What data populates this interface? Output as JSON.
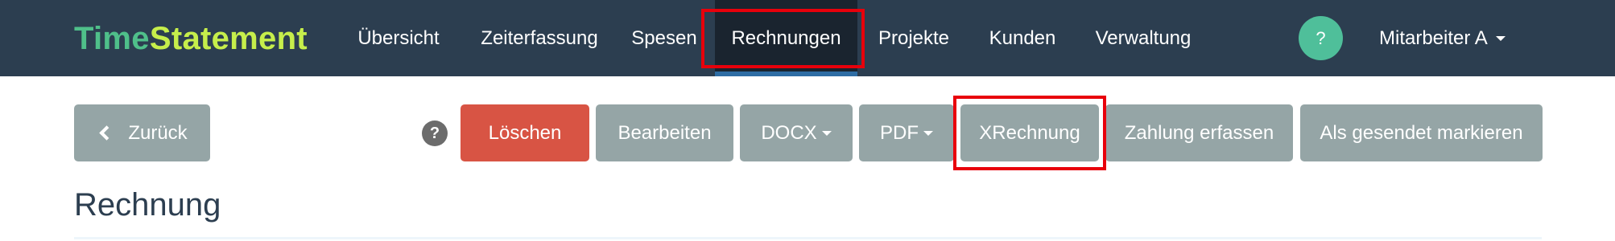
{
  "brand": {
    "part1": "Time",
    "part2": "Statement"
  },
  "nav": {
    "items": [
      {
        "label": "Übersicht"
      },
      {
        "label": "Zeiterfassung"
      },
      {
        "label": "Spesen"
      },
      {
        "label": "Rechnungen"
      },
      {
        "label": "Projekte"
      },
      {
        "label": "Kunden"
      },
      {
        "label": "Verwaltung"
      }
    ],
    "active": "Rechnungen",
    "help_label": "?",
    "user_label": "Mitarbeiter A"
  },
  "toolbar": {
    "back_label": "Zurück",
    "help_label": "?",
    "delete_label": "Löschen",
    "edit_label": "Bearbeiten",
    "docx_label": "DOCX",
    "pdf_label": "PDF",
    "xrechnung_label": "XRechnung",
    "payment_label": "Zahlung erfassen",
    "mark_sent_label": "Als gesendet markieren"
  },
  "page": {
    "title": "Rechnung"
  },
  "colors": {
    "navbar": "#2c3e50",
    "brand_time": "#4fbf8a",
    "brand_statement": "#c6ee4b",
    "button_default": "#95a5a6",
    "button_danger": "#d85444",
    "help_circle": "#4fbf9a",
    "highlight": "#e8000b"
  }
}
